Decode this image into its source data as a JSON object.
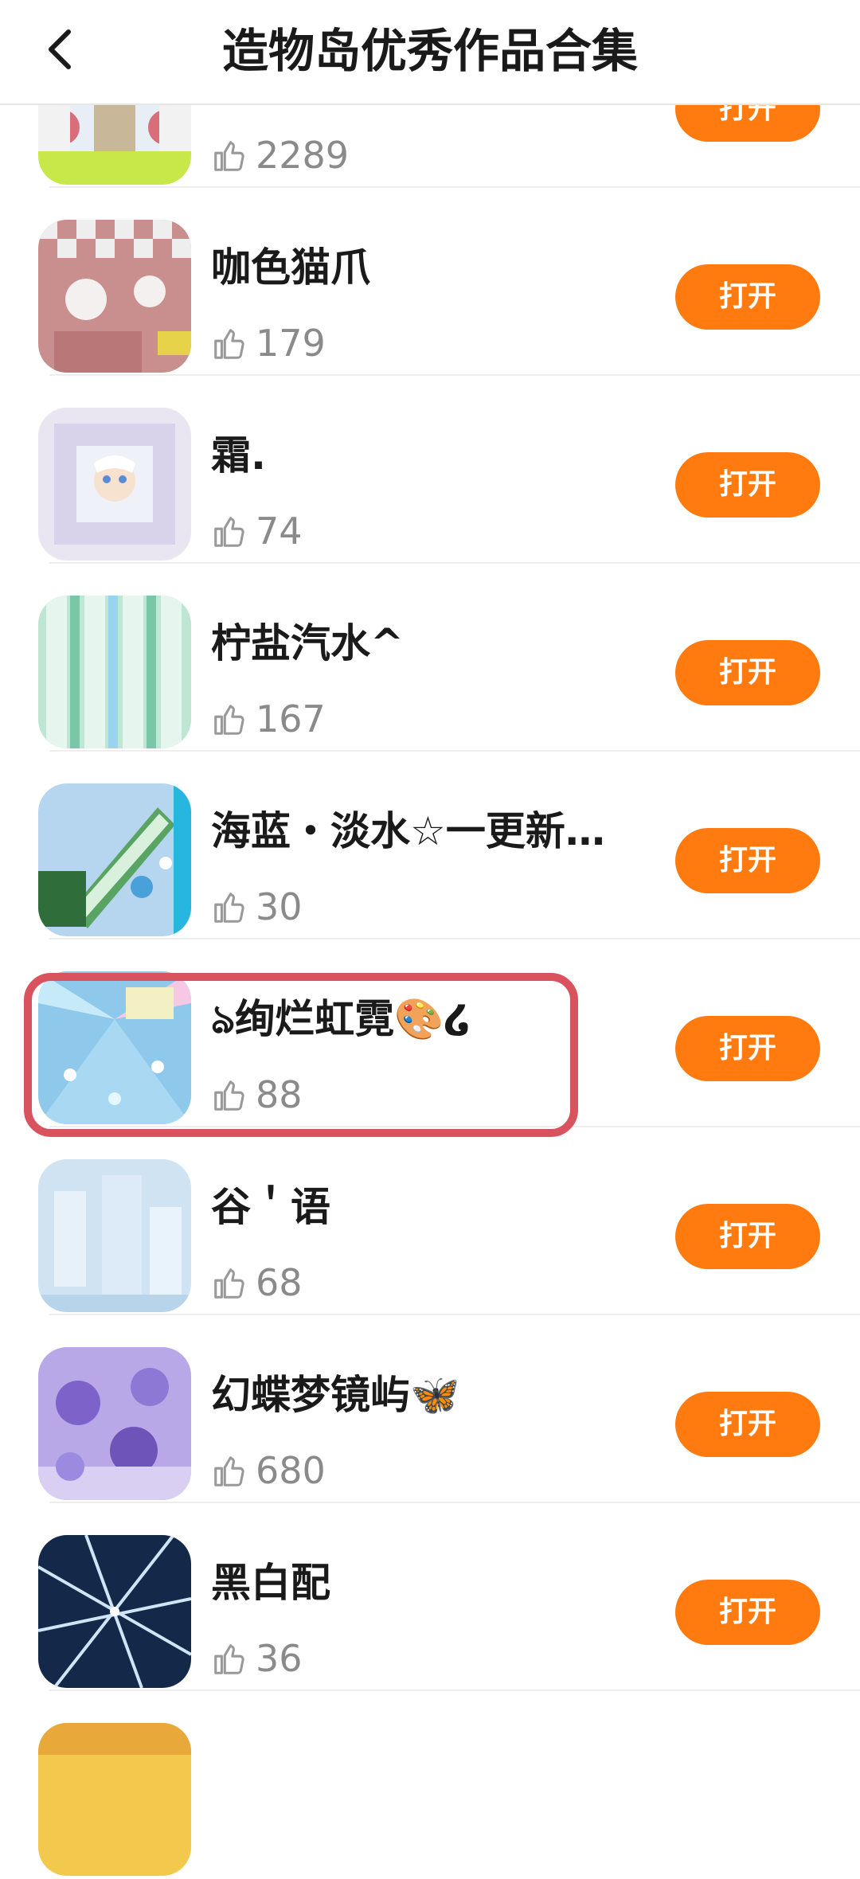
{
  "header": {
    "title": "造物岛优秀作品合集"
  },
  "open_label": "打开",
  "items": [
    {
      "title": "",
      "likes": "2289"
    },
    {
      "title": "咖色猫爪",
      "likes": "179"
    },
    {
      "title": "霜.",
      "likes": "74"
    },
    {
      "title": "柠盐汽水^",
      "likes": "167"
    },
    {
      "title": "海蓝・淡水☆一更新…",
      "likes": "30"
    },
    {
      "title": "ঌ绚烂虹霓🎨໒",
      "likes": "88"
    },
    {
      "title": "谷＇语",
      "likes": "68"
    },
    {
      "title": "幻蝶梦镜屿🦋",
      "likes": "680"
    },
    {
      "title": "黑白配",
      "likes": "36"
    }
  ],
  "colors": {
    "accent": "#ff7a0f",
    "highlight": "#d9535f"
  }
}
